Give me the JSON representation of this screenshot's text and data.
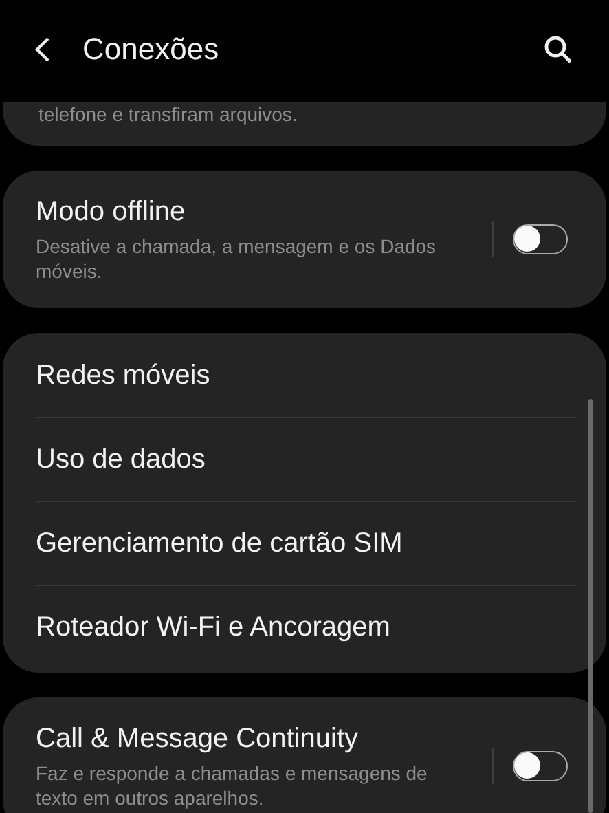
{
  "header": {
    "title": "Conexões"
  },
  "cards": [
    {
      "partial": true,
      "items": [
        {
          "kind": "description",
          "description": "telefone e transfiram arquivos."
        }
      ]
    },
    {
      "partial": false,
      "items": [
        {
          "kind": "toggle",
          "title": "Modo offline",
          "description": "Desative a chamada, a mensagem e os Dados móveis.",
          "on": false
        }
      ]
    },
    {
      "partial": false,
      "items": [
        {
          "kind": "link",
          "title": "Redes móveis"
        },
        {
          "kind": "link",
          "title": "Uso de dados"
        },
        {
          "kind": "link",
          "title": "Gerenciamento de cartão SIM"
        },
        {
          "kind": "link",
          "title": "Roteador Wi-Fi e Ancoragem"
        }
      ]
    },
    {
      "partial": false,
      "items": [
        {
          "kind": "toggle",
          "title": "Call & Message Continuity",
          "description": "Faz e responde a chamadas e mensagens de texto em outros aparelhos.",
          "on": false
        }
      ]
    }
  ]
}
